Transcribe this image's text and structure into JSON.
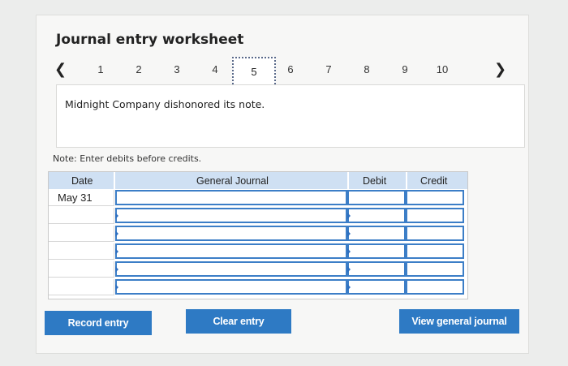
{
  "title": "Journal entry worksheet",
  "pager": {
    "prev_icon": "chevron-left-icon",
    "next_icon": "chevron-right-icon",
    "pages": [
      "1",
      "2",
      "3",
      "4",
      "5",
      "6",
      "7",
      "8",
      "9",
      "10"
    ],
    "active": "5"
  },
  "description": "Midnight Company dishonored its note.",
  "note": "Note: Enter debits before credits.",
  "table": {
    "headers": {
      "date": "Date",
      "journal": "General Journal",
      "debit": "Debit",
      "credit": "Credit"
    },
    "rows": [
      {
        "date": "May 31",
        "account": "",
        "debit": "",
        "credit": ""
      },
      {
        "date": "",
        "account": "",
        "debit": "",
        "credit": ""
      },
      {
        "date": "",
        "account": "",
        "debit": "",
        "credit": ""
      },
      {
        "date": "",
        "account": "",
        "debit": "",
        "credit": ""
      },
      {
        "date": "",
        "account": "",
        "debit": "",
        "credit": ""
      },
      {
        "date": "",
        "account": "",
        "debit": "",
        "credit": ""
      }
    ]
  },
  "buttons": {
    "record": "Record entry",
    "clear": "Clear entry",
    "view": "View general journal"
  },
  "colors": {
    "button": "#2e7ac4",
    "header": "#cfe0f3",
    "input_border": "#3c7ec7"
  }
}
